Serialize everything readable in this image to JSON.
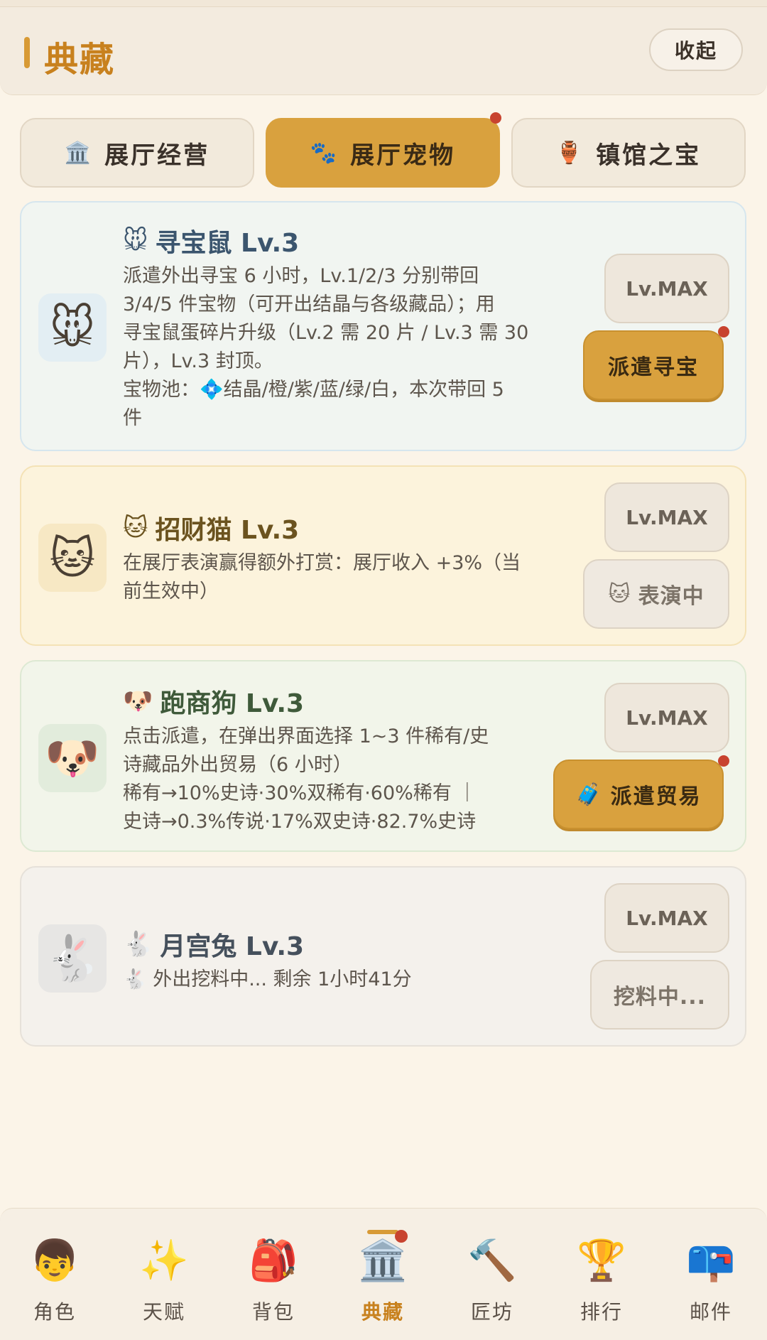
{
  "header": {
    "title": "典藏",
    "collapse_label": "收起"
  },
  "tabs": [
    {
      "icon": "🏛️",
      "label": "展厅经营",
      "active": false
    },
    {
      "icon": "🐾",
      "label": "展厅宠物",
      "active": true
    },
    {
      "icon": "🏺",
      "label": "镇馆之宝",
      "active": false
    }
  ],
  "pets": [
    {
      "avatar": "🐭",
      "title_icon": "🐭",
      "title": "寻宝鼠 Lv.3",
      "desc_lines": [
        "派遣外出寻宝 6 小时，Lv.1/2/3 分别带回",
        "3/4/5 件宝物（可开出结晶与各级藏品）；用",
        "寻宝鼠蛋碎片升级（Lv.2 需 20 片 / Lv.3 需 30",
        "片），Lv.3 封顶。",
        "宝物池：💠结晶/橙/紫/蓝/绿/白，本次带回 5",
        "件"
      ],
      "level_label": "Lv.MAX",
      "action_label": "派遣寻宝"
    },
    {
      "avatar": "🐱",
      "title_icon": "🐱",
      "title": "招财猫 Lv.3",
      "desc_lines": [
        "在展厅表演赢得额外打赏：展厅收入 +3%（当",
        "前生效中）"
      ],
      "level_label": "Lv.MAX",
      "action_icon": "🐱",
      "action_label": "表演中"
    },
    {
      "avatar": "🐶",
      "title_icon": "🐶",
      "title": "跑商狗 Lv.3",
      "desc_lines": [
        "点击派遣，在弹出界面选择 1~3 件稀有/史",
        "诗藏品外出贸易（6 小时）",
        "稀有→10%史诗·30%双稀有·60%稀有 ｜",
        "史诗→0.3%传说·17%双史诗·82.7%史诗"
      ],
      "level_label": "Lv.MAX",
      "action_icon": "🧳",
      "action_label": "派遣贸易"
    },
    {
      "avatar": "🐇",
      "title_icon": "🐇",
      "title": "月宫兔 Lv.3",
      "desc_lines": [
        "🐇 外出挖料中... 剩余 1小时41分"
      ],
      "level_label": "Lv.MAX",
      "action_label": "挖料中..."
    }
  ],
  "nav": [
    {
      "icon": "👦",
      "label": "角色"
    },
    {
      "icon": "✨",
      "label": "天赋"
    },
    {
      "icon": "🎒",
      "label": "背包"
    },
    {
      "icon": "🏛️",
      "label": "典藏",
      "active": true
    },
    {
      "icon": "🔨",
      "label": "匠坊"
    },
    {
      "icon": "🏆",
      "label": "排行"
    },
    {
      "icon": "📪",
      "label": "邮件"
    }
  ],
  "colors": {
    "accent": "#d9a13e",
    "title": "#c8811e",
    "badge": "#c8432f",
    "background": "#fbf4e8"
  }
}
